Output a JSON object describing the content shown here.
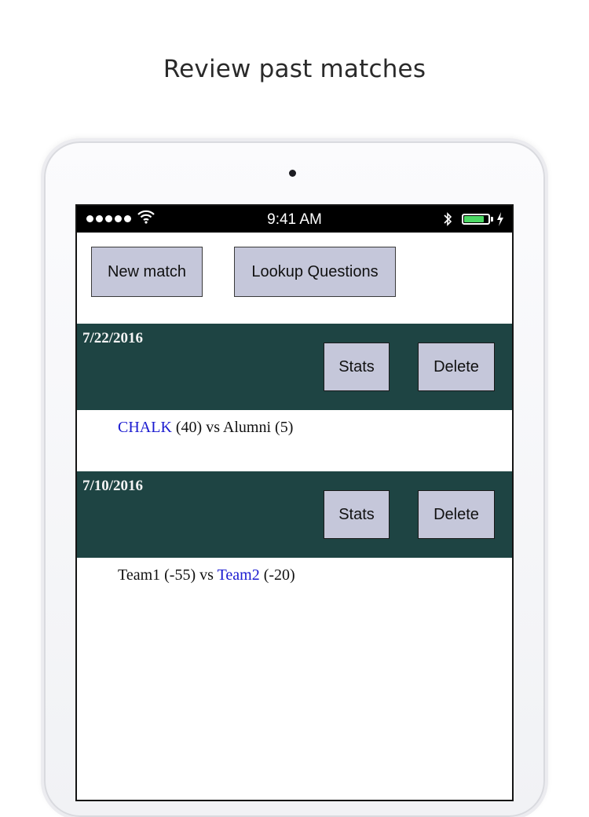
{
  "headline": "Review past matches",
  "status_bar": {
    "time": "9:41 AM",
    "battery_level": 0.85,
    "colors": {
      "battery": "#4cd964"
    }
  },
  "toolbar": {
    "new_match_label": "New match",
    "lookup_label": "Lookup Questions"
  },
  "colors": {
    "header_bg": "#1e4443",
    "button_bg": "#c5c7da",
    "link": "#1a1ad0"
  },
  "matches": [
    {
      "date": "7/22/2016",
      "stats_label": "Stats",
      "delete_label": "Delete",
      "team1": "CHALK",
      "team1_score": "(40)",
      "vs": "vs",
      "team2": "Alumni",
      "team2_score": "(5)",
      "winner": "team1"
    },
    {
      "date": "7/10/2016",
      "stats_label": "Stats",
      "delete_label": "Delete",
      "team1": "Team1",
      "team1_score": "(-55)",
      "vs": "vs",
      "team2": "Team2",
      "team2_score": "(-20)",
      "winner": "team2"
    }
  ]
}
